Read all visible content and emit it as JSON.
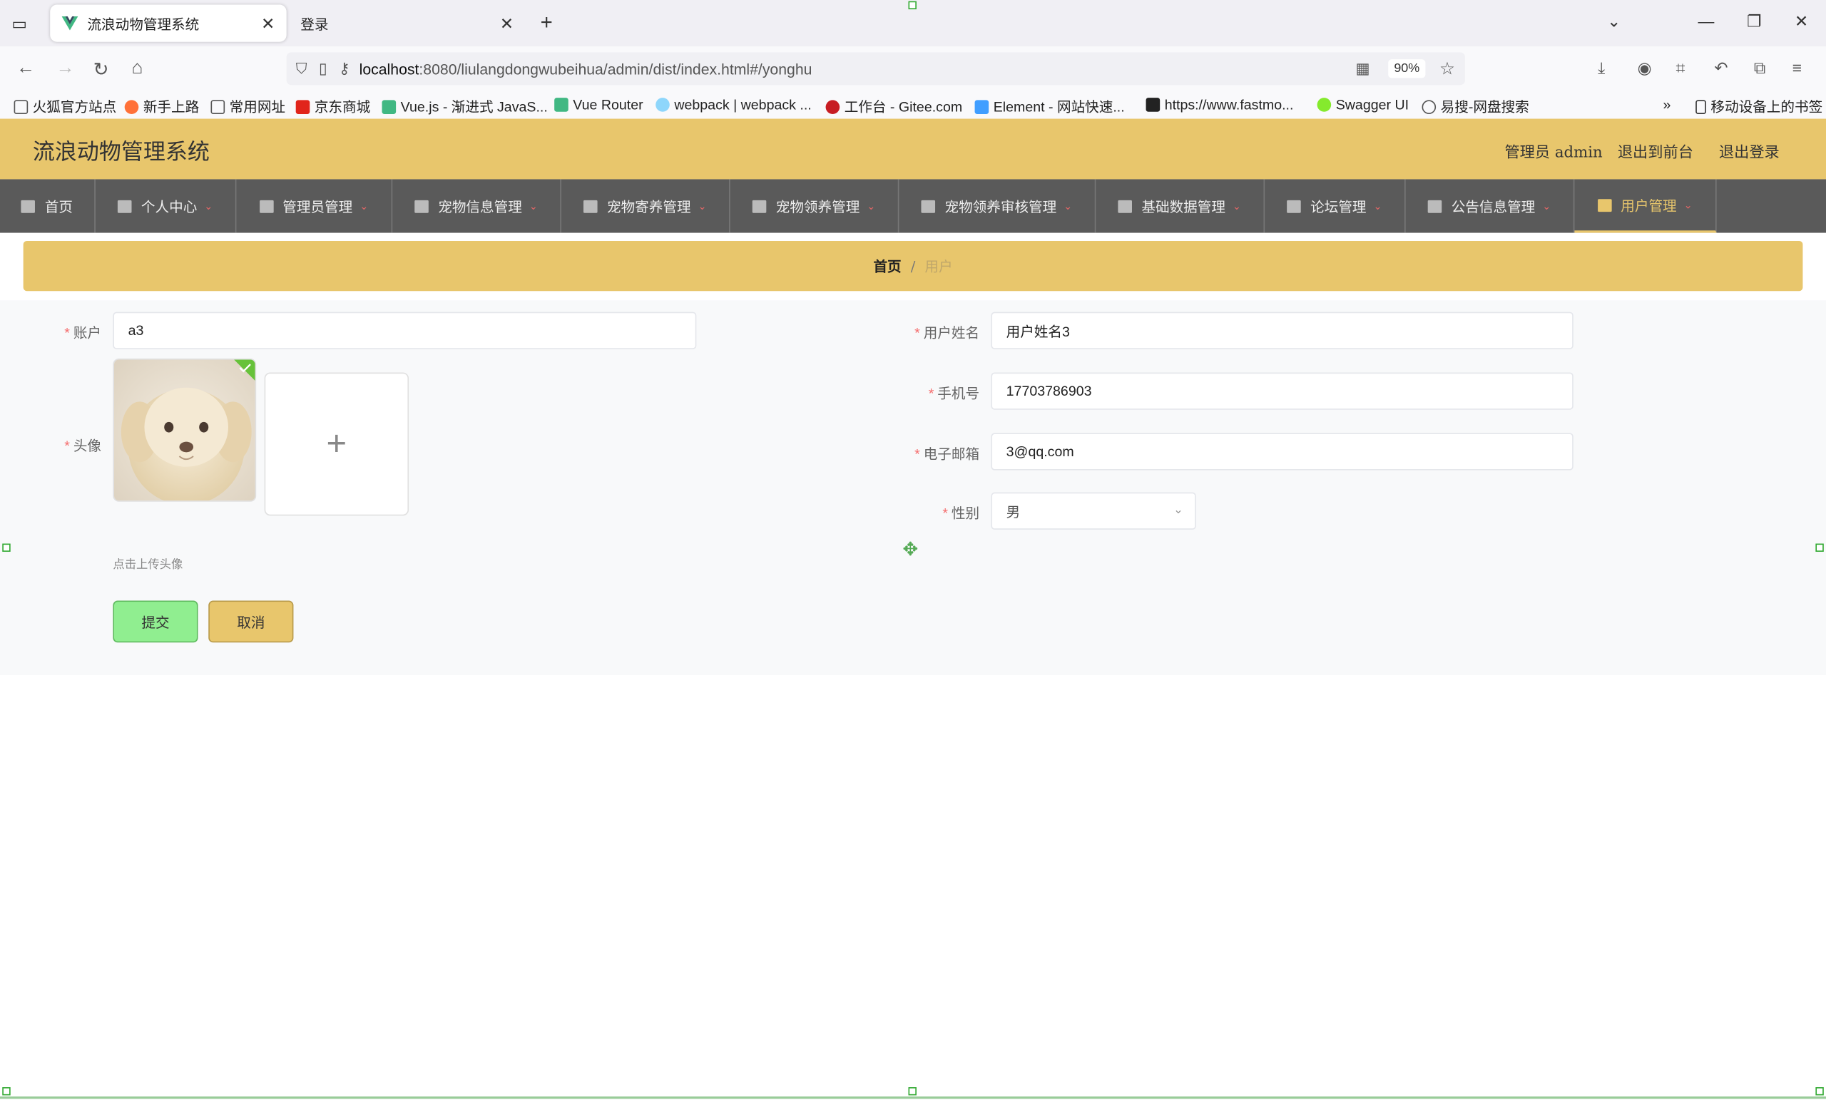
{
  "browser": {
    "tabs": [
      {
        "label": "流浪动物管理系统",
        "active": true
      },
      {
        "label": "登录",
        "active": false
      }
    ],
    "url_host": "localhost",
    "url_path": ":8080/liulangdongwubeihua/admin/dist/index.html#/yonghu",
    "zoom": "90%",
    "bookmarks": [
      {
        "label": "火狐官方站点",
        "icon": "folder-icon"
      },
      {
        "label": "新手上路",
        "icon": "firefox-icon"
      },
      {
        "label": "常用网址",
        "icon": "folder-icon"
      },
      {
        "label": "京东商城",
        "icon": "jd-icon"
      },
      {
        "label": "Vue.js - 渐进式 JavaS...",
        "icon": "vue-icon"
      },
      {
        "label": "Vue Router",
        "icon": "vue-icon"
      },
      {
        "label": "webpack | webpack ...",
        "icon": "webpack-icon"
      },
      {
        "label": "工作台 - Gitee.com",
        "icon": "gitee-icon"
      },
      {
        "label": "Element - 网站快速...",
        "icon": "element-icon"
      },
      {
        "label": "https://www.fastmo...",
        "icon": "fastmock-icon"
      },
      {
        "label": "Swagger UI",
        "icon": "swagger-icon"
      },
      {
        "label": "易搜-网盘搜索",
        "icon": "globe-icon"
      }
    ],
    "mobile_bookmarks": "移动设备上的书签"
  },
  "app": {
    "title": "流浪动物管理系统",
    "header_links": {
      "admin": "管理员 admin",
      "front": "退出到前台",
      "logout": "退出登录"
    },
    "menu": [
      {
        "label": "首页",
        "icon": "home-icon",
        "dropdown": false
      },
      {
        "label": "个人中心",
        "icon": "user-icon",
        "dropdown": true
      },
      {
        "label": "管理员管理",
        "icon": "sliders-icon",
        "dropdown": true
      },
      {
        "label": "宠物信息管理",
        "icon": "list-icon",
        "dropdown": true
      },
      {
        "label": "宠物寄养管理",
        "icon": "ticket-icon",
        "dropdown": true
      },
      {
        "label": "宠物领养管理",
        "icon": "clipboard-icon",
        "dropdown": true
      },
      {
        "label": "宠物领养审核管理",
        "icon": "book-icon",
        "dropdown": true
      },
      {
        "label": "基础数据管理",
        "icon": "stamp-icon",
        "dropdown": true
      },
      {
        "label": "论坛管理",
        "icon": "box-icon",
        "dropdown": true
      },
      {
        "label": "公告信息管理",
        "icon": "briefcase-icon",
        "dropdown": true
      },
      {
        "label": "用户管理",
        "icon": "list-icon",
        "dropdown": true,
        "active": true
      }
    ],
    "breadcrumb": {
      "home": "首页",
      "sep": "/",
      "current": "用户"
    },
    "form": {
      "account_label": "账户",
      "account_value": "a3",
      "avatar_label": "头像",
      "avatar_hint": "点击上传头像",
      "name_label": "用户姓名",
      "name_value": "用户姓名3",
      "phone_label": "手机号",
      "phone_value": "17703786903",
      "email_label": "电子邮箱",
      "email_value": "3@qq.com",
      "gender_label": "性别",
      "gender_value": "男",
      "submit_label": "提交",
      "cancel_label": "取消"
    },
    "colors": {
      "accent": "#e8c66c",
      "menu_bg": "#5a5a5a",
      "submit": "#90ee90",
      "required": "#f56c6c"
    }
  }
}
